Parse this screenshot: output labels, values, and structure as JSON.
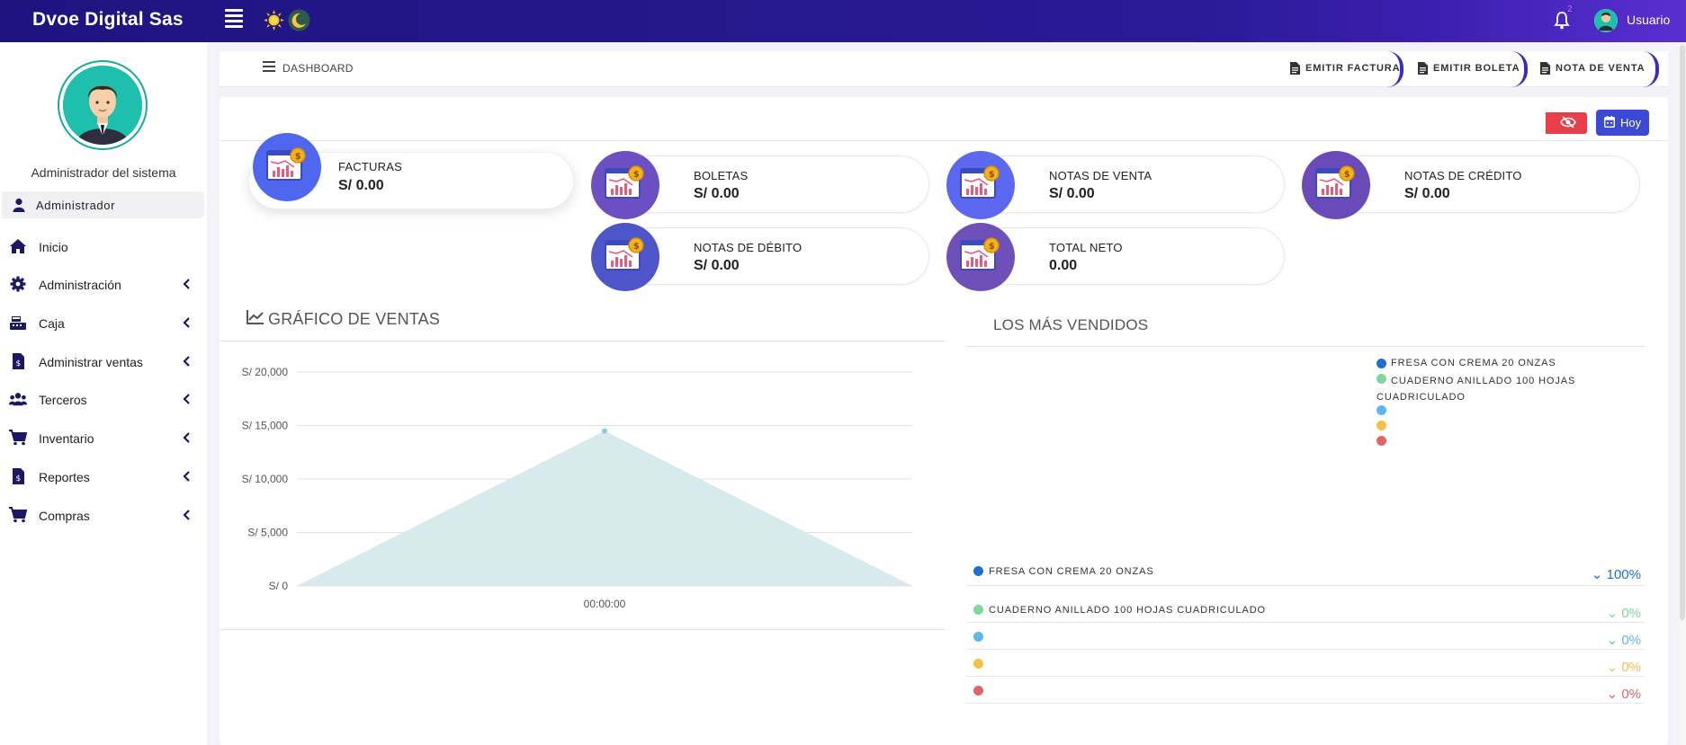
{
  "app": {
    "brand": "Dvoe Digital Sas",
    "notification_count": "2",
    "user_label": "Usuario"
  },
  "sidebar": {
    "profile_title": "Administrador del sistema",
    "role": "Administrador",
    "items": [
      {
        "label": "Inicio",
        "icon": "home-icon",
        "has_submenu": false
      },
      {
        "label": "Administración",
        "icon": "gear-icon",
        "has_submenu": true
      },
      {
        "label": "Caja",
        "icon": "cash-register-icon",
        "has_submenu": true
      },
      {
        "label": "Administrar ventas",
        "icon": "invoice-icon",
        "has_submenu": true
      },
      {
        "label": "Terceros",
        "icon": "users-icon",
        "has_submenu": true
      },
      {
        "label": "Inventario",
        "icon": "cart-icon",
        "has_submenu": true
      },
      {
        "label": "Reportes",
        "icon": "report-icon",
        "has_submenu": true
      },
      {
        "label": "Compras",
        "icon": "cart-icon",
        "has_submenu": true
      }
    ]
  },
  "breadcrumb": {
    "label": "DASHBOARD"
  },
  "actions": {
    "emitir_factura": "EMITIR FACTURA",
    "emitir_boleta": "EMITIR BOLETA",
    "nota_venta": "NOTA DE VENTA"
  },
  "toolbar": {
    "today_label": "Hoy"
  },
  "cards": [
    {
      "title": "FACTURAS",
      "value": "S/ 0.00"
    },
    {
      "title": "BOLETAS",
      "value": "S/ 0.00"
    },
    {
      "title": "NOTAS DE VENTA",
      "value": "S/ 0.00"
    },
    {
      "title": "NOTAS DE CRÉDITO",
      "value": "S/ 0.00"
    },
    {
      "title": "NOTAS DE DÉBITO",
      "value": "S/ 0.00"
    },
    {
      "title": "TOTAL NETO",
      "value": "0.00"
    }
  ],
  "sales_chart": {
    "title": "GRÁFICO DE VENTAS"
  },
  "chart_data": {
    "type": "area",
    "title": "",
    "categories": [
      "",
      "00:00:00",
      ""
    ],
    "values": [
      0,
      14500,
      0
    ],
    "ylim": [
      0,
      20000
    ],
    "y_ticks": [
      "S/ 0",
      "S/ 5,000",
      "S/ 10,000",
      "S/ 15,000",
      "S/ 20,000"
    ],
    "x_ticks": [
      "00:00:00"
    ],
    "grid": true,
    "fill_color": "#d9eaed",
    "point_color": "#8ccae6"
  },
  "top_sellers": {
    "title": "LOS MÁS VENDIDOS",
    "legend": [
      {
        "label": "FRESA CON CREMA 20 ONZAS",
        "color": "#1f6fd1"
      },
      {
        "label": "CUADERNO ANILLADO 100 HOJAS CUADRICULADO",
        "color": "#7ed6a0"
      },
      {
        "label": "",
        "color": "#5cb6ef"
      },
      {
        "label": "",
        "color": "#f5bf4a"
      },
      {
        "label": "",
        "color": "#e06469"
      }
    ],
    "rows": [
      {
        "label": "FRESA CON CREMA 20 ONZAS",
        "pct": "100%",
        "color": "#1f6fd1"
      },
      {
        "label": "CUADERNO ANILLADO 100 HOJAS CUADRICULADO",
        "pct": "0%",
        "color": "#7ed6a0"
      },
      {
        "label": "",
        "pct": "0%",
        "color": "#5cb6ef"
      },
      {
        "label": "",
        "pct": "0%",
        "color": "#f5bf4a"
      },
      {
        "label": "",
        "pct": "0%",
        "color": "#e06469"
      }
    ]
  }
}
